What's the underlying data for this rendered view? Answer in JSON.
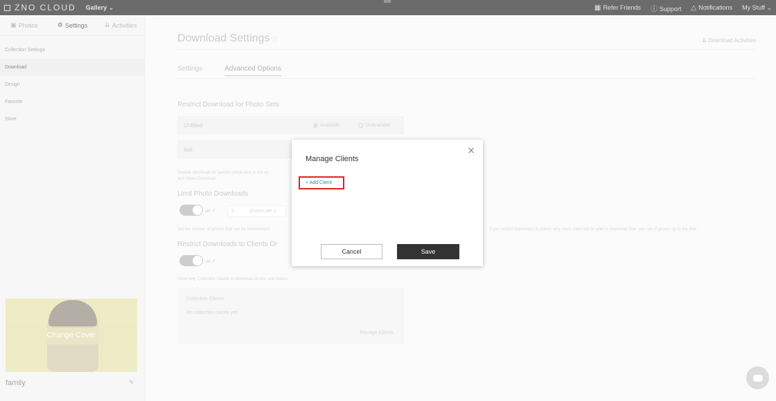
{
  "topbar": {
    "logo": "ZNO CLOUD",
    "gallery": "Gallery ⌄",
    "refer_friends": "Refer Friends",
    "support": "Support",
    "notifications": "Notifications",
    "my_stuff": "My Stuff ⌄"
  },
  "sidebar": {
    "tabs": [
      "Photos",
      "Settings",
      "Activities"
    ],
    "menu": [
      "Collection Settings",
      "Download",
      "Design",
      "Favorite",
      "Store"
    ],
    "cover_label": "Change Cover",
    "album_name": "family"
  },
  "main": {
    "title": "Download Settings",
    "download_activities": "Download Activities",
    "tabs": [
      "Settings",
      "Advanced Options"
    ],
    "restrict_sets_title": "Restrict Download for Photo Sets",
    "set_rows": [
      "Untitled",
      "test"
    ],
    "available": "Available",
    "unavailable": "Unavailable",
    "restrict_help": "Disable download for specific photo sets in the co",
    "restrict_help2": "and Video Download.",
    "limit_title": "Limit Photo Downloads",
    "toggle_on": "on",
    "limit_value": "5",
    "limit_unit": "photos per c",
    "limit_help": "Set the number of photos that can be downloaded",
    "limit_help_right": "If you restrict downloads to clients only, each client will be able to download their own set of photos up to the limit.",
    "clients_title": "Restrict Downloads to Clients Or",
    "clients_help": "Allow only Collection Clients to download photos and videos.",
    "clients_card_title": "Collection Clients",
    "clients_empty": "No collection clients yet!",
    "clients_manage": "Manage Clients"
  },
  "modal": {
    "title": "Manage Clients",
    "add_client": "+ Add Client",
    "cancel": "Cancel",
    "save": "Save",
    "close_icon": "×"
  },
  "colors": {
    "highlight": "#dd2222",
    "link": "#3b7fd4",
    "save_bg": "#333333"
  }
}
